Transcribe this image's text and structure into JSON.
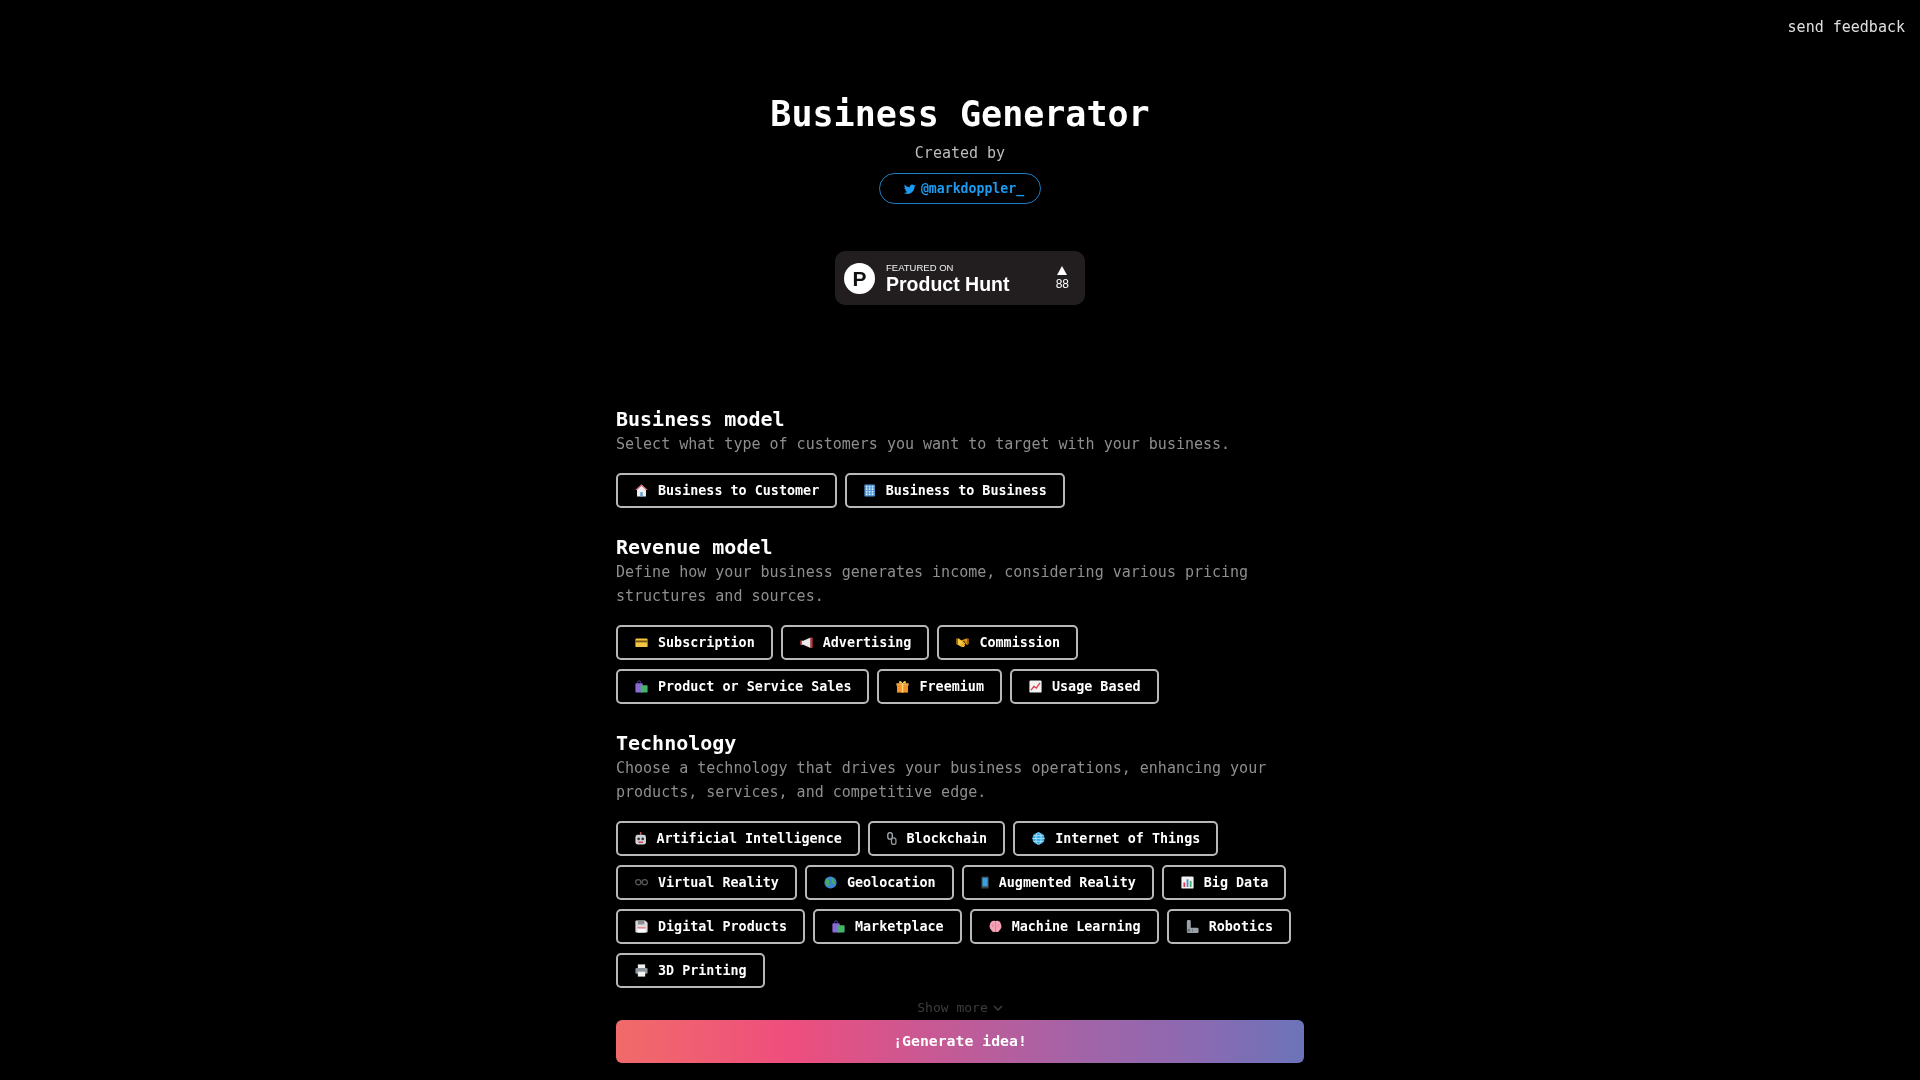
{
  "header": {
    "feedback_link": "send feedback",
    "title": "Business Generator",
    "credit_label": "Created by",
    "twitter_handle": "@markdoppler_"
  },
  "badge": {
    "logo_letter": "P",
    "label": "FEATURED ON",
    "name": "Product Hunt",
    "votes": "88"
  },
  "sections": [
    {
      "title": "Business model",
      "description": "Select what type of customers you want to target with your business.",
      "options": [
        {
          "kind": "house",
          "label": "Business to Customer",
          "selected": false
        },
        {
          "kind": "office",
          "label": "Business to Business",
          "selected": false
        }
      ]
    },
    {
      "title": "Revenue model",
      "description": "Define how your business generates income, considering various pricing structures and sources.",
      "options": [
        {
          "kind": "card",
          "label": "Subscription",
          "selected": false
        },
        {
          "kind": "megaphone",
          "label": "Advertising",
          "selected": false
        },
        {
          "kind": "handshake",
          "label": "Commission",
          "selected": false
        },
        {
          "kind": "bags",
          "label": "Product or Service Sales",
          "selected": false
        },
        {
          "kind": "gift",
          "label": "Freemium",
          "selected": false
        },
        {
          "kind": "trend",
          "label": "Usage Based",
          "selected": false
        }
      ]
    },
    {
      "title": "Technology",
      "description": "Choose a technology that drives your business operations, enhancing your products, services, and competitive edge.",
      "options": [
        {
          "kind": "robot",
          "label": "Artificial Intelligence",
          "selected": false
        },
        {
          "kind": "chain",
          "label": "Blockchain",
          "selected": false
        },
        {
          "kind": "globe",
          "label": "Internet of Things",
          "selected": false
        },
        {
          "kind": "glasses",
          "label": "Virtual Reality",
          "selected": false
        },
        {
          "kind": "earth",
          "label": "Geolocation",
          "selected": false
        },
        {
          "kind": "phone",
          "label": "Augmented Reality",
          "selected": false
        },
        {
          "kind": "barchart",
          "label": "Big Data",
          "selected": false
        },
        {
          "kind": "floppy",
          "label": "Digital Products",
          "selected": false
        },
        {
          "kind": "bags",
          "label": "Marketplace",
          "selected": false
        },
        {
          "kind": "brain",
          "label": "Machine Learning",
          "selected": false
        },
        {
          "kind": "arm",
          "label": "Robotics",
          "selected": false
        },
        {
          "kind": "printer",
          "label": "3D Printing",
          "selected": false
        }
      ]
    }
  ],
  "show_more": {
    "label": "Show more"
  },
  "generate_button": {
    "label": "¡Generate idea!"
  }
}
